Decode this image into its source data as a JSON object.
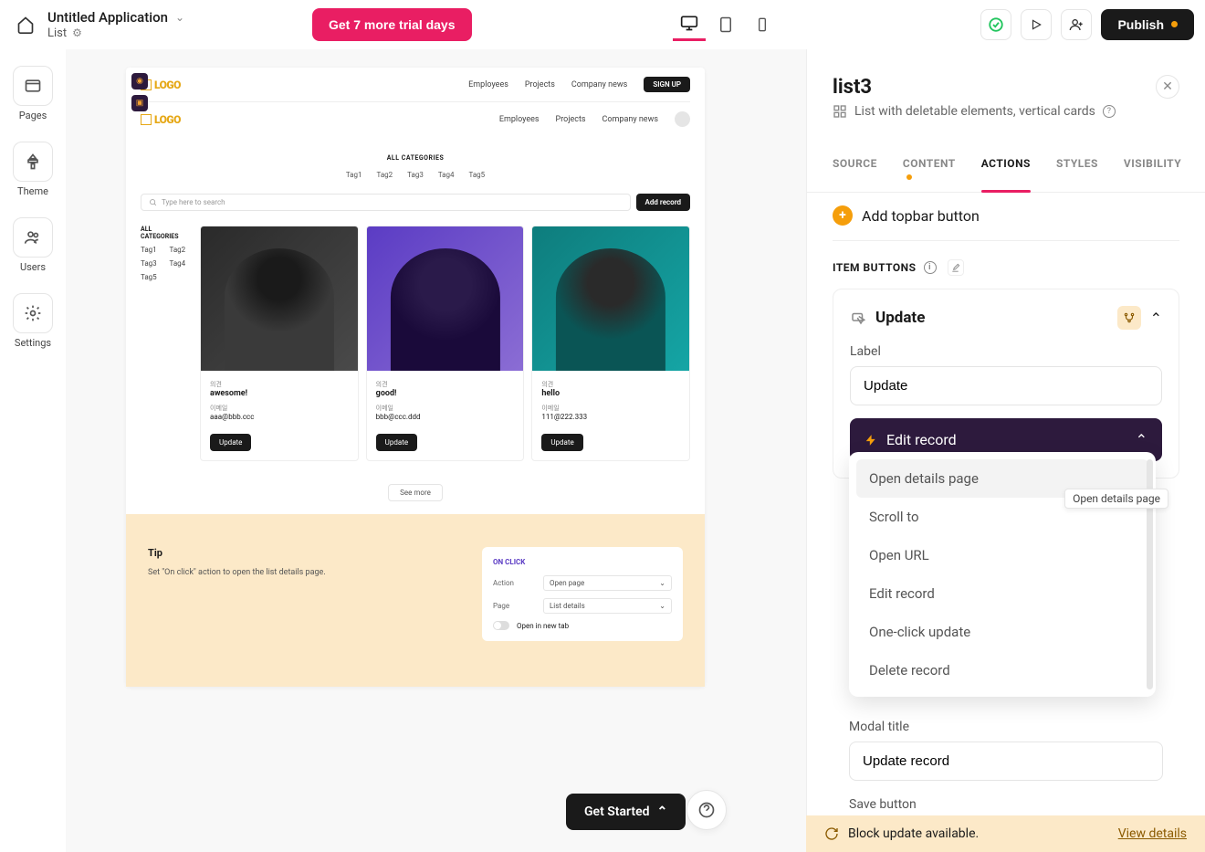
{
  "topbar": {
    "app_title": "Untitled Application",
    "breadcrumb": "List",
    "trial_btn": "Get 7 more trial days",
    "publish": "Publish"
  },
  "sidebar": {
    "items": [
      {
        "label": "Pages"
      },
      {
        "label": "Theme"
      },
      {
        "label": "Users"
      },
      {
        "label": "Settings"
      }
    ]
  },
  "preview": {
    "logo": "LOGO",
    "nav": [
      "Employees",
      "Projects",
      "Company news"
    ],
    "signup": "SIGN UP",
    "all_categories": "ALL CATEGORIES",
    "tags": [
      "Tag1",
      "Tag2",
      "Tag3",
      "Tag4",
      "Tag5"
    ],
    "search_placeholder": "Type here to search",
    "add_record": "Add record",
    "side_tags_title": "ALL CATEGORIES",
    "cards": [
      {
        "f1_lbl": "의견",
        "f1_val": "awesome!",
        "f2_lbl": "이메일",
        "f2_val": "aaa@bbb.ccc",
        "btn": "Update"
      },
      {
        "f1_lbl": "의견",
        "f1_val": "good!",
        "f2_lbl": "이메일",
        "f2_val": "bbb@ccc.ddd",
        "btn": "Update"
      },
      {
        "f1_lbl": "의견",
        "f1_val": "hello",
        "f2_lbl": "이메일",
        "f2_val": "111@222.333",
        "btn": "Update"
      }
    ],
    "see_more": "See more"
  },
  "tip": {
    "title": "Tip",
    "text": "Set \"On click\" action to open the list details page.",
    "card_header": "ON CLICK",
    "action_lbl": "Action",
    "action_val": "Open page",
    "page_lbl": "Page",
    "page_val": "List details",
    "new_tab": "Open in new tab"
  },
  "get_started": "Get Started",
  "panel": {
    "title": "list3",
    "subtitle": "List with deletable elements, vertical cards",
    "tabs": [
      "SOURCE",
      "CONTENT",
      "ACTIONS",
      "STYLES",
      "VISIBILITY"
    ],
    "add_topbar": "Add topbar button",
    "section_h": "ITEM BUTTONS",
    "item_title": "Update",
    "label_lbl": "Label",
    "label_val": "Update",
    "edit_record": "Edit record",
    "modal_title_lbl": "Modal title",
    "modal_title_val": "Update record",
    "save_btn_lbl": "Save button"
  },
  "dropdown": {
    "items": [
      "Open details page",
      "Scroll to",
      "Open URL",
      "Edit record",
      "One-click update",
      "Delete record"
    ],
    "tooltip": "Open details page"
  },
  "banner": {
    "text": "Block update available.",
    "link": "View details"
  }
}
